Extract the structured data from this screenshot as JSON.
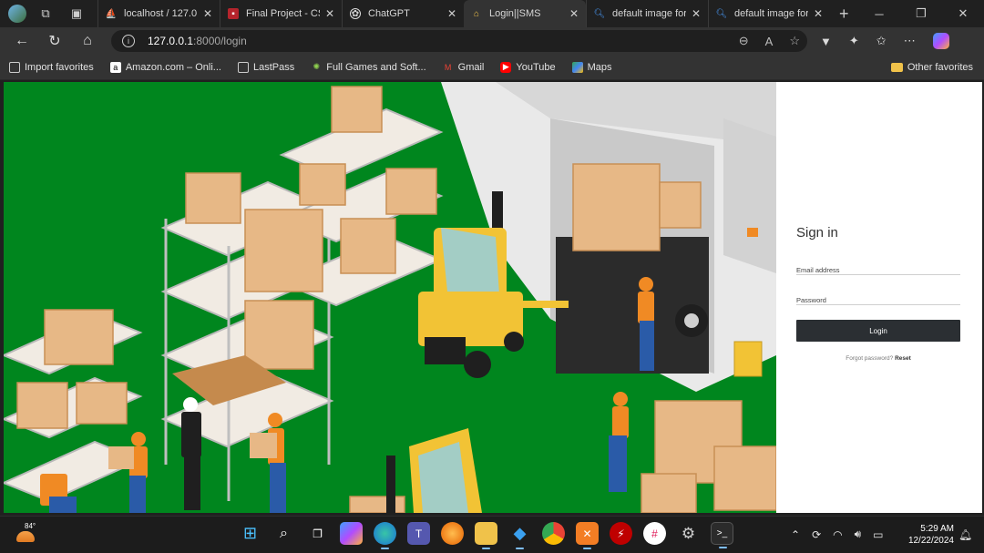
{
  "browser": {
    "tabs": [
      {
        "title": "localhost / 127.0.0.1",
        "favicon": "phpmyadmin-icon",
        "active": false
      },
      {
        "title": "Final Project - CSE",
        "favicon": "university-icon",
        "active": false
      },
      {
        "title": "ChatGPT",
        "favicon": "chatgpt-icon",
        "active": false
      },
      {
        "title": "Login||SMS",
        "favicon": "warehouse-icon",
        "active": true
      },
      {
        "title": "default image for",
        "favicon": "search-icon",
        "active": false
      },
      {
        "title": "default image for",
        "favicon": "search-icon",
        "active": false
      }
    ],
    "address": {
      "host": "127.0.0.1",
      "path": ":8000/login"
    },
    "favorites": [
      {
        "label": "Import favorites"
      },
      {
        "label": "Amazon.com – Onli..."
      },
      {
        "label": "LastPass"
      },
      {
        "label": "Full Games and Soft..."
      },
      {
        "label": "Gmail"
      },
      {
        "label": "YouTube"
      },
      {
        "label": "Maps"
      }
    ],
    "other_favorites": "Other favorites"
  },
  "login": {
    "heading": "Sign in",
    "email_label": "Email address",
    "password_label": "Password",
    "button": "Login",
    "forgot_text": "Forgot password?",
    "reset_link": "Reset"
  },
  "taskbar": {
    "temperature": "84°",
    "time": "5:29 AM",
    "date": "12/22/2024"
  },
  "colors": {
    "floor": "#00861e",
    "wall": "#e9e9e9",
    "button": "#2b2f33",
    "box": "#e7b886",
    "forklift": "#f2c335",
    "worker_vest": "#f08a24",
    "worker_pants": "#2a5ba8"
  }
}
